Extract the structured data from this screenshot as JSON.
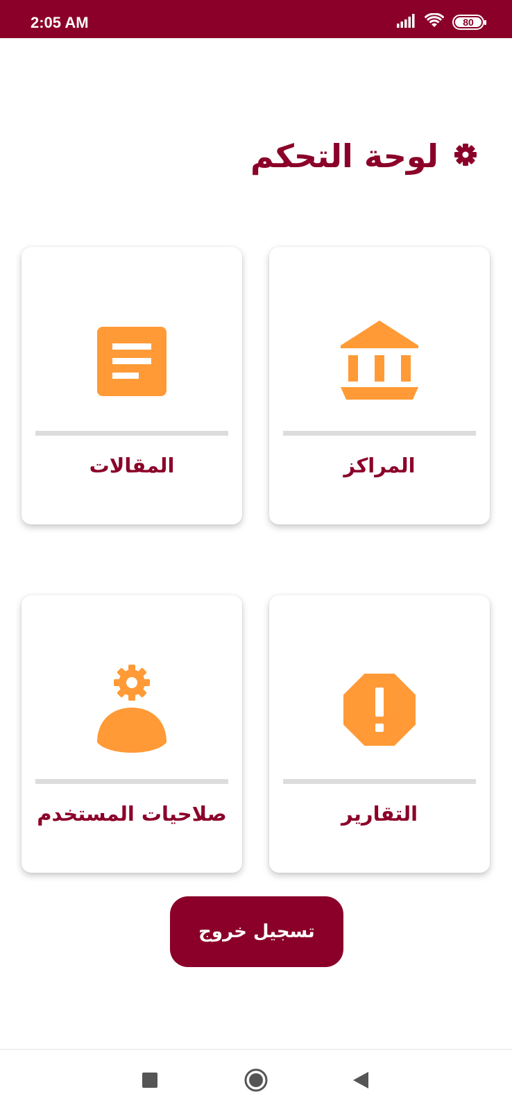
{
  "status_bar": {
    "time": "2:05 AM",
    "battery": "80",
    "icons": [
      "signal-icon",
      "wifi-icon",
      "battery-icon"
    ]
  },
  "header": {
    "title": "لوحة التحكم",
    "icon": "gear-icon"
  },
  "cards": [
    {
      "label": "المراكز",
      "icon": "bank-icon"
    },
    {
      "label": "المقالات",
      "icon": "article-icon"
    },
    {
      "label": "التقارير",
      "icon": "report-alert-icon"
    },
    {
      "label": "صلاحيات المستخدم",
      "icon": "user-settings-icon"
    }
  ],
  "logout": {
    "label": "تسجيل خروج"
  },
  "nav": {
    "icons": [
      "recents-icon",
      "home-icon",
      "back-icon"
    ]
  },
  "colors": {
    "primary": "#8b0029",
    "accent": "#ff9a36",
    "divider": "#dcdcdc",
    "background": "#ffffff"
  }
}
